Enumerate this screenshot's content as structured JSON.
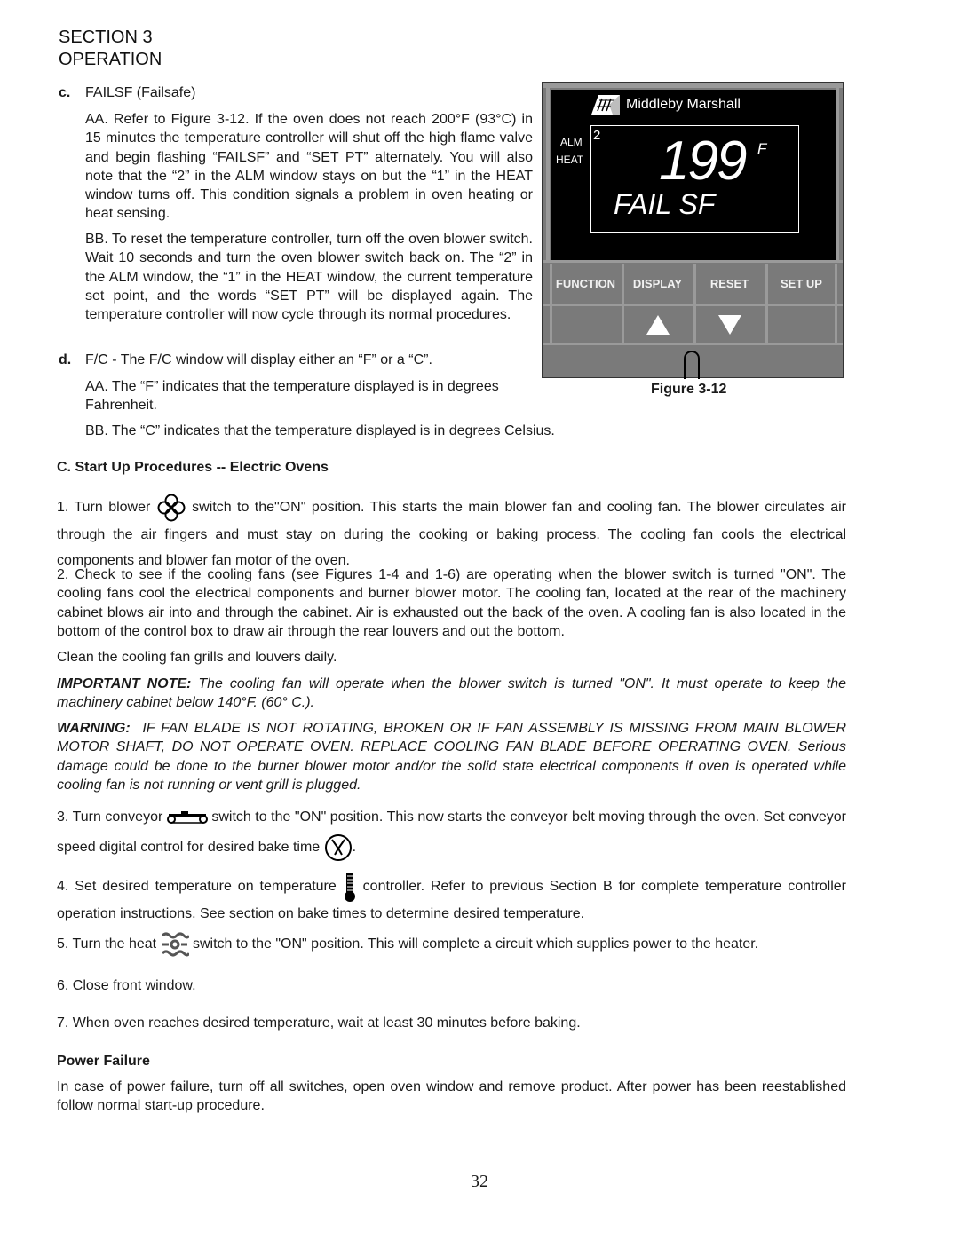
{
  "header": {
    "section": "SECTION 3",
    "title": "OPERATION"
  },
  "failsafe": {
    "label": "c.",
    "heading": "FAILSF (Failsafe)",
    "aa": "AA. Refer to Figure 3-12. If the oven does not reach 200°F (93°C) in 15 minutes the temperature controller will shut off the high flame valve and begin flashing “FAILSF” and “SET PT” alternately. You will also note that the “2” in the ALM window stays on but the “1” in the HEAT window turns off. This condition signals a problem in oven heating or heat sensing.",
    "bb": "BB. To reset the temperature controller, turn off the oven blower switch. Wait 10 seconds and turn the oven blower switch back on. The “2” in the ALM window, the “1” in the HEAT window, the current temperature set point, and the words “SET PT” will be displayed again. The temperature controller will now cycle through its normal procedures."
  },
  "fc": {
    "label": "d.",
    "heading": "F/C - The F/C window will display either an “F” or a “C”.",
    "aa": "AA. The “F” indicates that the temperature displayed is in degrees Fahrenheit.",
    "bb": "BB. The “C” indicates that the temperature displayed is in degrees Celsius."
  },
  "figure": {
    "brand": "Middleby Marshall",
    "alm_label": "ALM",
    "heat_label": "HEAT",
    "alm_value": "2",
    "temperature": "199",
    "unit": "F",
    "status": "FAIL SF",
    "buttons": [
      "FUNCTION",
      "DISPLAY",
      "RESET",
      "SET UP"
    ],
    "arrow_keys": [
      "up-arrow",
      "down-arrow"
    ],
    "caption": "Figure 3-12",
    "colors": {
      "panel": "#7a7a7a",
      "grid": "#9a9a9a",
      "screen": "#000000",
      "text": "#ffffff"
    }
  },
  "startup": {
    "heading": "C. Start Up Procedures -- Electric Ovens",
    "step1_pre": "1. Turn blower",
    "step1_post": "switch to the\"ON\" position. This starts the main blower fan and cooling fan. The blower circulates air through the air fingers and must stay on during the cooking or baking process. The cooling fan cools the electrical components and blower fan motor of the oven.",
    "step2": "2. Check to see if the cooling fans (see Figures 1-4 and 1-6) are operating when the blower switch is turned \"ON\". The cooling fans cool the electrical components and burner blower motor. The cooling fan, located at the rear of the machinery cabinet blows air into and through the cabinet. Air is exhausted out the back of the oven. A cooling fan is also located in the bottom of the control box to draw air through the rear louvers and out the bottom.",
    "clean": "Clean the cooling fan grills and louvers daily.",
    "note_label": "IMPORTANT NOTE:",
    "note_text": "The cooling fan will operate when the blower switch is turned \"ON\". It must operate to keep the machinery cabinet below 140°F. (60° C.).",
    "warning_label": "WARNING:",
    "warning_text": "IF FAN BLADE IS NOT ROTATING, BROKEN OR IF FAN ASSEMBLY IS MISSING FROM MAIN BLOWER MOTOR SHAFT, DO NOT OPERATE OVEN. REPLACE COOLING FAN BLADE BEFORE OPERATING OVEN. Serious damage could be done to the burner blower motor and/or the solid state electrical components if oven is operated while cooling fan is not running or vent grill is plugged.",
    "step3_pre": "3. Turn conveyor",
    "step3_mid": "switch to the \"ON\" position. This now starts the conveyor belt moving through the oven. Set conveyor speed digital control for desired bake time",
    "step3_post": ".",
    "step4_pre": "4. Set desired temperature on temperature",
    "step4_post": "controller. Refer to previous Section B for complete temperature controller operation instructions. See section on bake times to determine desired temperature.",
    "step5_pre": "5. Turn the heat",
    "step5_post": "switch to the \"ON\" position. This will complete a circuit which supplies power to the heater.",
    "step6": "6. Close front window.",
    "step7": "7. When oven reaches desired temperature, wait at least 30 minutes before baking."
  },
  "power_failure": {
    "heading": "Power Failure",
    "text": "In case of power failure, turn off all switches, open oven window and remove product. After power has been reestablished follow normal start-up procedure."
  },
  "page_number": "32"
}
